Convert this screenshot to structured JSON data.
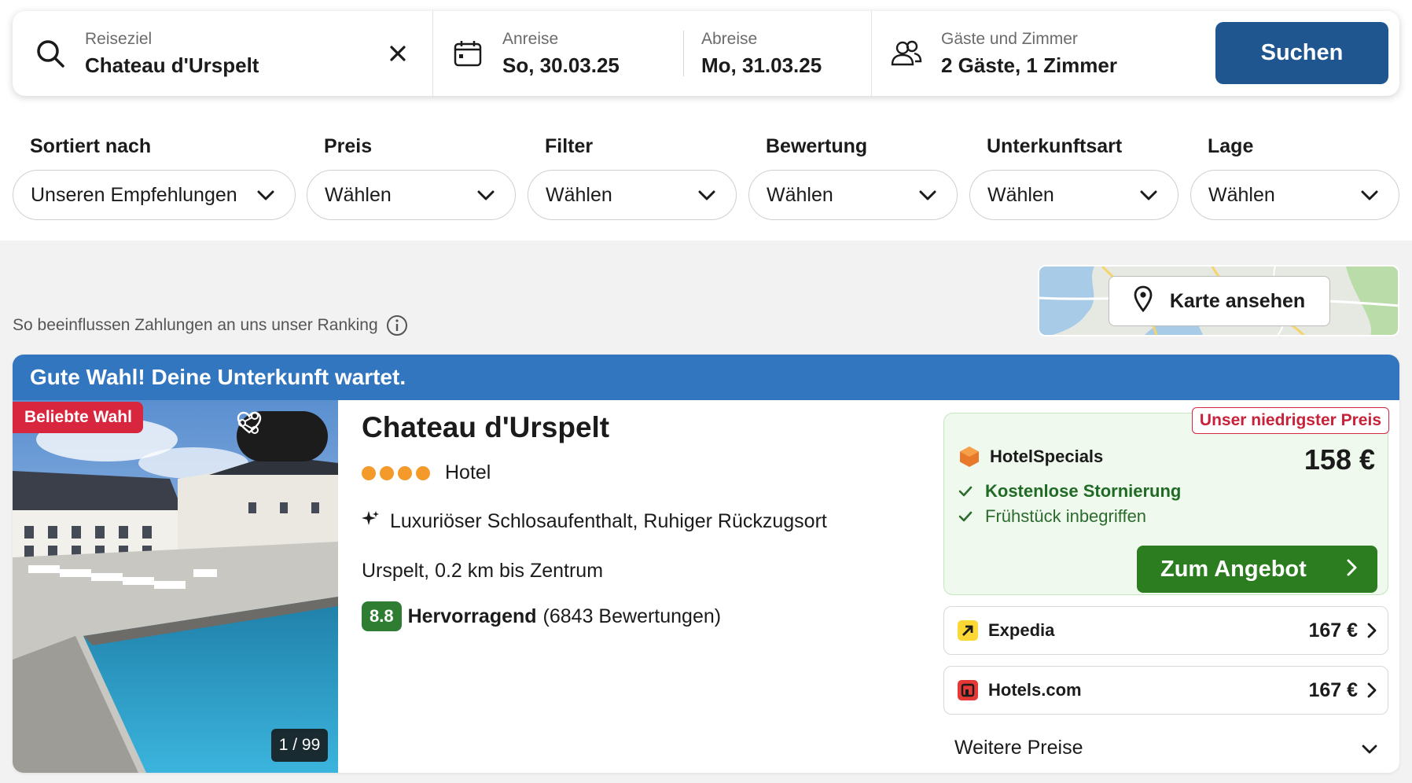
{
  "search": {
    "destination_label": "Reiseziel",
    "destination_value": "Chateau d'Urspelt",
    "checkin_label": "Anreise",
    "checkin_value": "So, 30.03.25",
    "checkout_label": "Abreise",
    "checkout_value": "Mo, 31.03.25",
    "guests_label": "Gäste und Zimmer",
    "guests_value": "2 Gäste, 1 Zimmer",
    "search_button": "Suchen"
  },
  "filters": [
    {
      "label": "Sortiert nach",
      "value": "Unseren Empfehlungen"
    },
    {
      "label": "Preis",
      "value": "Wählen"
    },
    {
      "label": "Filter",
      "value": "Wählen"
    },
    {
      "label": "Bewertung",
      "value": "Wählen"
    },
    {
      "label": "Unterkunftsart",
      "value": "Wählen"
    },
    {
      "label": "Lage",
      "value": "Wählen"
    }
  ],
  "ranking_note": "So beeinflussen Zahlungen an uns unser Ranking",
  "map_button": "Karte ansehen",
  "result": {
    "banner": "Gute Wahl! Deine Unterkunft wartet.",
    "popular_badge": "Beliebte Wahl",
    "photo_counter": "1 / 99",
    "name": "Chateau d'Urspelt",
    "stars": 4,
    "type": "Hotel",
    "features": "Luxuriöser Schlosaufenthalt, Ruhiger Rückzugsort",
    "location": "Urspelt, 0.2 km bis Zentrum",
    "rating_score": "8.8",
    "rating_word": "Hervorragend",
    "rating_count": "(6843 Bewertungen)",
    "best_offer": {
      "tag": "Unser niedrigster Preis",
      "provider": "HotelSpecials",
      "price": "158 €",
      "perks": [
        "Kostenlose Stornierung",
        "Frühstück inbegriffen"
      ],
      "cta": "Zum Angebot"
    },
    "other_offers": [
      {
        "provider": "Expedia",
        "price": "167 €"
      },
      {
        "provider": "Hotels.com",
        "price": "167 €"
      }
    ],
    "more_prices": "Weitere Preise"
  },
  "colors": {
    "search_button": "#1f5690",
    "banner": "#3276bf",
    "popular_badge": "#d9263f",
    "cta": "#2b7d1f",
    "rating": "#2e7d32",
    "star": "#f39a2b"
  }
}
